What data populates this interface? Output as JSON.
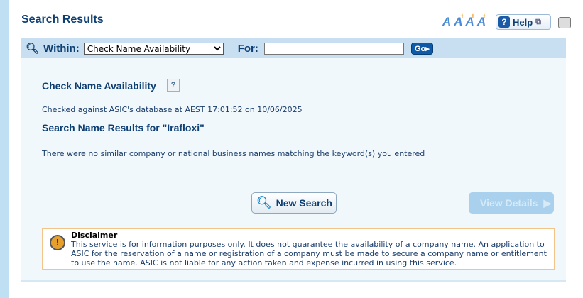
{
  "header": {
    "title": "Search Results",
    "font_size_label": "AAAA",
    "help_label": "Help"
  },
  "search": {
    "within_label": "Within:",
    "within_value": "Check Name Availability",
    "for_label": "For:",
    "for_value": "",
    "go_label": "Go"
  },
  "main": {
    "heading": "Check Name Availability",
    "help_icon": "?",
    "checked": "Checked against ASIC's database at AEST 17:01:52 on 10/06/2025",
    "results_heading": "Search Name Results for \"Irafloxi\"",
    "no_results": "There were no similar company or national business names matching the keyword(s) you entered",
    "new_search": "New Search",
    "view_details": "View Details"
  },
  "disclaimer": {
    "title": "Disclaimer",
    "text": "This service is for information purposes only. It does not guarantee the availability of a company name. An application to ASIC for the reservation of a name or registration of a company must be made to secure a company name or entitlement to use the name. ASIC is not liable for any action taken and expense incurred in using this service."
  }
}
